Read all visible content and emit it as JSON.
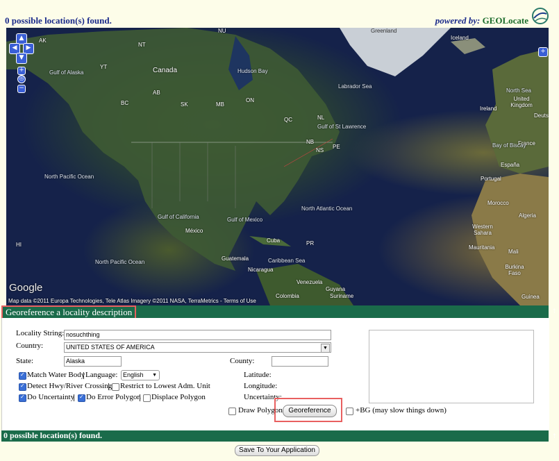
{
  "top": {
    "status": "0 possible location(s) found.",
    "powered_by": "powered by:",
    "brand": "GEOLocate"
  },
  "map": {
    "labels": {
      "canada": "Canada",
      "hudson_bay": "Hudson Bay",
      "labrador_sea": "Labrador Sea",
      "greenland": "Greenland",
      "iceland": "Iceland",
      "north_sea": "North Sea",
      "united_kingdom": "United Kingdom",
      "ireland": "Ireland",
      "france": "France",
      "espana": "España",
      "portugal": "Portugal",
      "morocco": "Morocco",
      "algeria": "Algeria",
      "western_sahara": "Western Sahara",
      "mauritania": "Mauritania",
      "mali": "Mali",
      "burkina_faso": "Burkina Faso",
      "guinea": "Guinea",
      "mexico": "México",
      "cuba": "Cuba",
      "guatemala": "Guatemala",
      "nicaragua": "Nicaragua",
      "venezuela": "Venezuela",
      "colombia": "Colombia",
      "guyana": "Guyana",
      "suriname": "Suriname",
      "north_pacific_ocean": "North Pacific Ocean",
      "north_atlantic_ocean": "North Atlantic Ocean",
      "gulf_of_alaska": "Gulf of Alaska",
      "gulf_of_mexico": "Gulf of Mexico",
      "gulf_of_california": "Gulf of California",
      "gulf_of_st_lawrence": "Gulf of St Lawrence",
      "bay_of_biscay": "Bay of Biscay",
      "caribbean_sea": "Caribbean Sea",
      "ak": "AK",
      "nu": "NU",
      "nt": "NT",
      "yt": "YT",
      "bc": "BC",
      "ab": "AB",
      "sk": "SK",
      "mb": "MB",
      "on": "ON",
      "qc": "QC",
      "nl": "NL",
      "nb": "NB",
      "ns": "NS",
      "pe": "PE",
      "hi": "HI",
      "pr": "PR",
      "deutschland": "Deuts"
    },
    "google": "Google",
    "credit": "Map data ©2011 Europa Technologies, Tele Atlas Imagery ©2011 NASA, TerraMetrics - Terms of Use"
  },
  "georef": {
    "header": "Georeference a locality description",
    "locality_label": "Locality String:",
    "locality_value": "nosuchthing",
    "country_label": "Country:",
    "country_value": "UNITED STATES OF AMERICA",
    "state_label": "State:",
    "state_value": "Alaska",
    "county_label": "County:",
    "county_value": "",
    "match_water": "Match Water Body",
    "language_label": "Language:",
    "language_value": "English",
    "detect_hwy": "Detect Hwy/River Crossing",
    "restrict_lowest": "Restrict to Lowest Adm. Unit",
    "do_uncertainty": "Do Uncertainty",
    "do_error_polygon": "Do Error Polygon",
    "displace_polygon": "Displace Polygon",
    "latitude_label": "Latitude:",
    "longitude_label": "Longitude:",
    "uncertainty_label": "Uncertainty:",
    "draw_polygon": "Draw Polygon",
    "georeference_button": "Georeference",
    "bg_label": "+BG (may slow things down)"
  },
  "bottom": {
    "status": "0 possible location(s) found.",
    "save_button": "Save To Your Application"
  }
}
